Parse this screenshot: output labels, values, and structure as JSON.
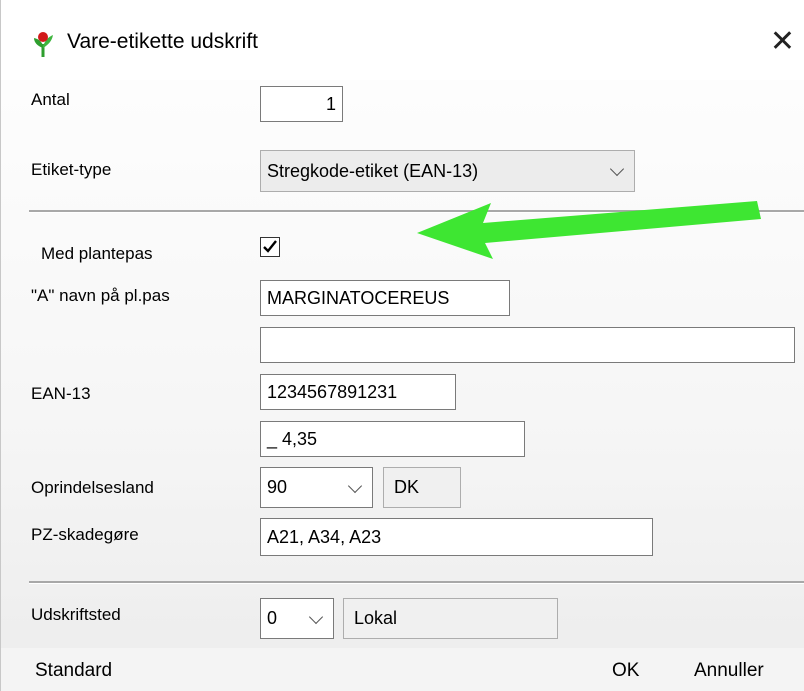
{
  "window": {
    "title": "Vare-etikette udskrift",
    "close_glyph": "✕"
  },
  "fields": {
    "antal": {
      "label": "Antal",
      "value": "1"
    },
    "etiket_type": {
      "label": "Etiket-type",
      "selected": "Stregkode-etiket (EAN-13)"
    },
    "med_plantepas": {
      "label": "Med plantepas",
      "checked": true
    },
    "a_navn": {
      "label": "\"A\" navn på pl.pas",
      "value": "MARGINATOCEREUS"
    },
    "extra": {
      "value": ""
    },
    "ean13": {
      "label": "EAN-13",
      "value": "1234567891231"
    },
    "price": {
      "value": "_ 4,35"
    },
    "oprindelsesland": {
      "label": "Oprindelsesland",
      "selected": "90",
      "country": "DK"
    },
    "pz_skadegore": {
      "label": "PZ-skadegøre",
      "value": "A21, A34, A23"
    },
    "udskriftsted": {
      "label": "Udskriftsted",
      "selected": "0",
      "location": "Lokal"
    }
  },
  "buttons": {
    "standard": "Standard",
    "ok": "OK",
    "cancel": "Annuller"
  },
  "icons": {
    "app": "plant-icon",
    "close": "close-icon",
    "dropdown": "chevron-down-icon",
    "check": "checkmark-icon",
    "annotation": "green-arrow-icon"
  },
  "colors": {
    "arrow": "#3ee632",
    "leaf": "#2e9e2e",
    "bud": "#d11a1a"
  }
}
